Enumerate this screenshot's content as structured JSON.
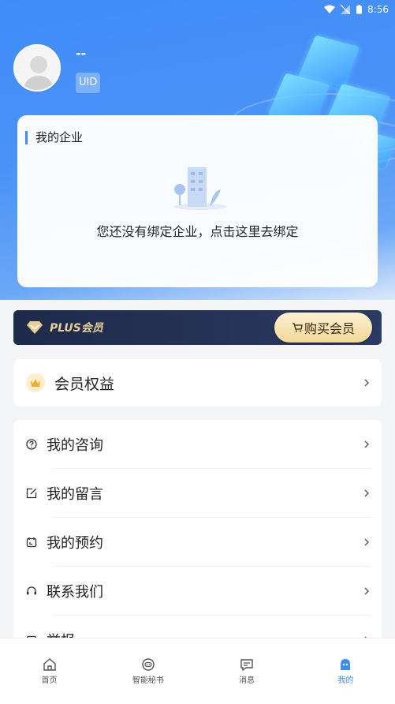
{
  "status_bar": {
    "time": "8:56"
  },
  "profile": {
    "name": "--",
    "uid_label": "UID"
  },
  "enterprise": {
    "title": "我的企业",
    "empty_hint": "您还没有绑定企业，点击这里去绑定"
  },
  "plus": {
    "label": "PLUS会员",
    "buy_label": "购买会员"
  },
  "rights": {
    "label": "会员权益"
  },
  "menu": {
    "items": [
      {
        "label": "我的咨询",
        "icon": "question-circle-icon"
      },
      {
        "label": "我的留言",
        "icon": "edit-icon"
      },
      {
        "label": "我的预约",
        "icon": "calendar-icon"
      },
      {
        "label": "联系我们",
        "icon": "headset-icon"
      },
      {
        "label": "举报",
        "icon": "report-icon"
      }
    ]
  },
  "tabs": [
    {
      "label": "首页",
      "icon": "home-icon"
    },
    {
      "label": "智能秘书",
      "icon": "robot-icon"
    },
    {
      "label": "消息",
      "icon": "message-icon"
    },
    {
      "label": "我的",
      "icon": "profile-icon",
      "active": true
    }
  ],
  "colors": {
    "accent": "#3f8cf8",
    "plus_bg": "#1e2a4a",
    "gold": "#e9cf96"
  }
}
